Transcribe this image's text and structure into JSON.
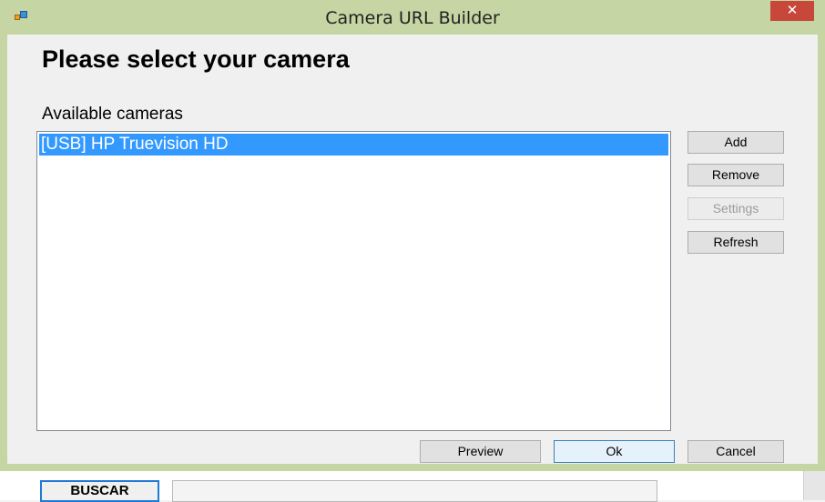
{
  "window": {
    "title": "Camera URL Builder",
    "close_glyph": "✕"
  },
  "heading": "Please select your camera",
  "cameras": {
    "label": "Available cameras",
    "items": [
      {
        "label": "[USB] HP Truevision HD",
        "selected": true
      }
    ]
  },
  "side_buttons": {
    "add": "Add",
    "remove": "Remove",
    "settings": "Settings",
    "refresh": "Refresh"
  },
  "footer_buttons": {
    "preview": "Preview",
    "ok": "Ok",
    "cancel": "Cancel"
  },
  "background_app": {
    "search_button": "BUSCAR",
    "search_value": ""
  },
  "colors": {
    "selection": "#3399ff",
    "close": "#c7473a",
    "frame": "#c5d5a3"
  },
  "icons": {
    "app": "app-window-icon",
    "close": "close-icon"
  }
}
